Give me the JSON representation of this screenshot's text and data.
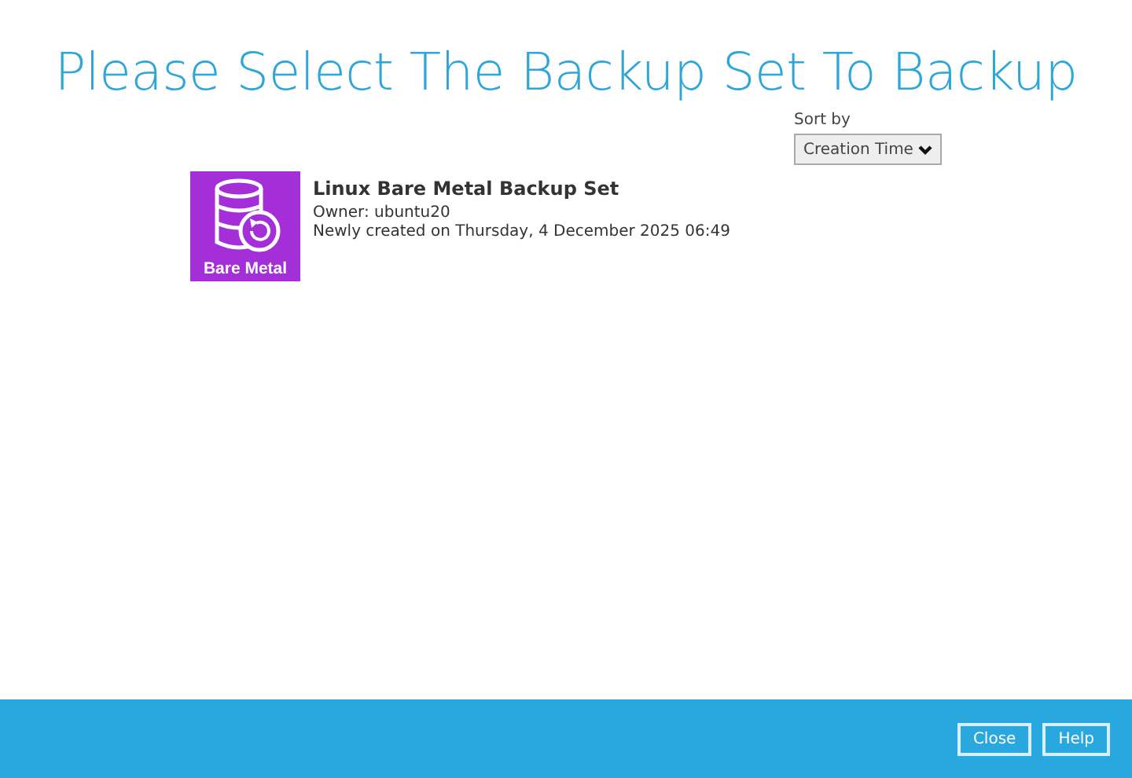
{
  "title": "Please Select The Backup Set To Backup",
  "sort": {
    "label": "Sort by",
    "value": "Creation Time"
  },
  "backup_sets": [
    {
      "icon_label": "Bare Metal",
      "name": "Linux Bare Metal Backup Set",
      "owner": "Owner: ubuntu20",
      "created": "Newly created on Thursday, 4 December 2025 06:49"
    }
  ],
  "buttons": [
    "Close",
    "Help"
  ]
}
